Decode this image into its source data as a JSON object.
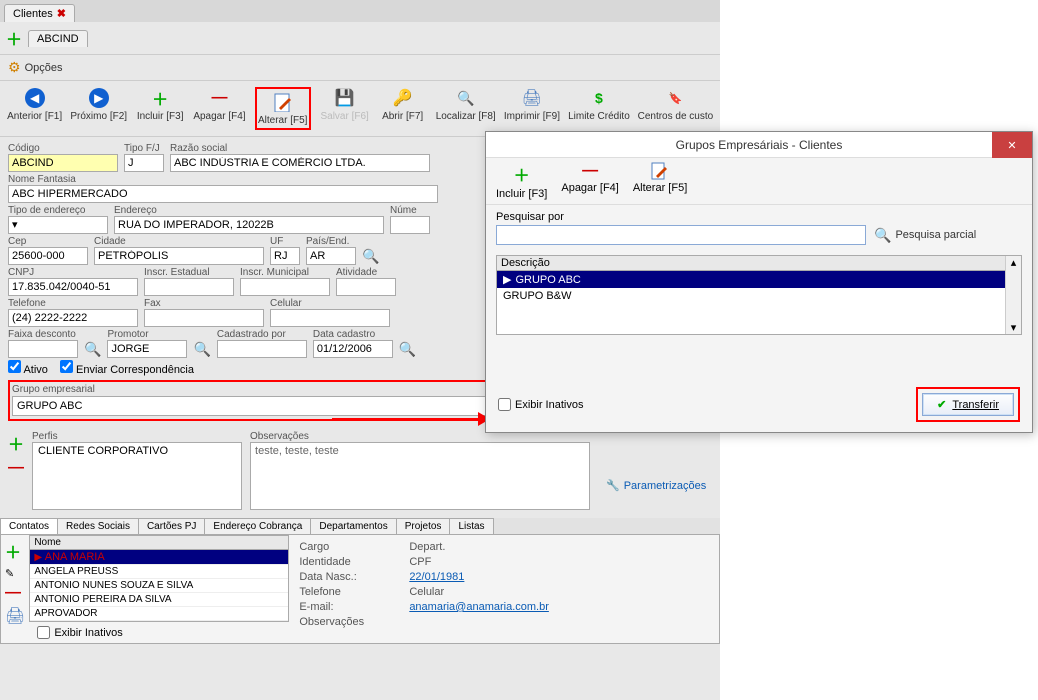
{
  "main_window": {
    "tab": {
      "label": "Clientes"
    },
    "subtab": "ABCIND",
    "opcoes": "Opções",
    "toolbar": {
      "anterior": "Anterior [F1]",
      "proximo": "Próximo [F2]",
      "incluir": "Incluir [F3]",
      "apagar": "Apagar [F4]",
      "alterar": "Alterar [F5]",
      "salvar": "Salvar [F6]",
      "abrir": "Abrir [F7]",
      "localizar": "Localizar [F8]",
      "imprimir": "Imprimir [F9]",
      "limite": "Limite Crédito",
      "centros": "Centros de custo"
    },
    "form": {
      "codigo_label": "Código",
      "codigo": "ABCIND",
      "tipo_label": "Tipo F/J",
      "tipo": "J",
      "razao_label": "Razão social",
      "razao": "ABC INDÚSTRIA E COMÉRCIO LTDA.",
      "fantasia_label": "Nome Fantasia",
      "fantasia": "ABC HIPERMERCADO",
      "tipo_end_label": "Tipo de endereço",
      "endereco_label": "Endereço",
      "endereco": "RUA DO IMPERADOR, 12022B",
      "numero_label": "Núme",
      "cep_label": "Cep",
      "cep": "25600-000",
      "cidade_label": "Cidade",
      "cidade": "PETRÓPOLIS",
      "uf_label": "UF",
      "uf": "RJ",
      "pais_label": "País/End.",
      "pais": "AR",
      "cnpj_label": "CNPJ",
      "cnpj": "17.835.042/0040-51",
      "ie_label": "Inscr. Estadual",
      "im_label": "Inscr. Municipal",
      "atividade_label": "Atividade",
      "telefone_label": "Telefone",
      "telefone": "(24) 2222-2222",
      "fax_label": "Fax",
      "celular_label": "Celular",
      "faixa_label": "Faixa desconto",
      "promotor_label": "Promotor",
      "promotor": "JORGE",
      "cadastrado_label": "Cadastrado por",
      "data_label": "Data cadastro",
      "data": "01/12/2006",
      "ativo": "Ativo",
      "enviar": "Enviar Correspondência",
      "grupo_label": "Grupo empresarial",
      "grupo": "GRUPO ABC",
      "perfis_label": "Perfis",
      "perfis_item": "CLIENTE CORPORATIVO",
      "obs_label": "Observações",
      "obs": "teste, teste, teste",
      "param": "Parametrizações"
    },
    "subtabs": {
      "contatos": "Contatos",
      "redes": "Redes Sociais",
      "cartoes": "Cartões PJ",
      "endereco": "Endereço Cobrança",
      "departamentos": "Departamentos",
      "projetos": "Projetos",
      "listas": "Listas"
    },
    "contacts": {
      "header": "Nome",
      "rows": [
        "ANA MARIA",
        "ANGELA PREUSS",
        "ANTONIO NUNES SOUZA E SILVA",
        "ANTONIO PEREIRA DA SILVA",
        "APROVADOR"
      ],
      "detail": {
        "cargo_k": "Cargo",
        "depart_k": "Depart.",
        "identidade_k": "Identidade",
        "cpf_k": "CPF",
        "datanasc_k": "Data Nasc.:",
        "datanasc_v": "22/01/1981",
        "telefone_k": "Telefone",
        "celular_k": "Celular",
        "email_k": "E-mail:",
        "email_v": "anamaria@anamaria.com.br",
        "obs_k": "Observações"
      },
      "exibir": "Exibir Inativos"
    }
  },
  "modal": {
    "title": "Grupos Empresáriais - Clientes",
    "toolbar": {
      "incluir": "Incluir [F3]",
      "apagar": "Apagar [F4]",
      "alterar": "Alterar [F5]"
    },
    "search_label": "Pesquisar por",
    "partial": "Pesquisa parcial",
    "list_header": "Descrição",
    "rows": [
      "GRUPO ABC",
      "GRUPO B&W"
    ],
    "exibir": "Exibir Inativos",
    "transfer": "Transferir"
  }
}
